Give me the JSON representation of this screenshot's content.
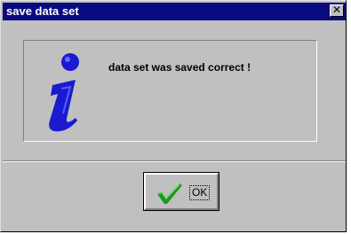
{
  "window": {
    "title": "save data set",
    "close_glyph": "✕"
  },
  "message": {
    "text": "data set was saved correct !",
    "icon": "info-icon"
  },
  "buttons": {
    "ok_label": "OK",
    "ok_icon": "checkmark-icon"
  },
  "colors": {
    "titlebar": "#0a0a80",
    "dialog_bg": "#c0c0c0",
    "icon_blue": "#1a1ad0",
    "check_green": "#1a9a1a"
  }
}
